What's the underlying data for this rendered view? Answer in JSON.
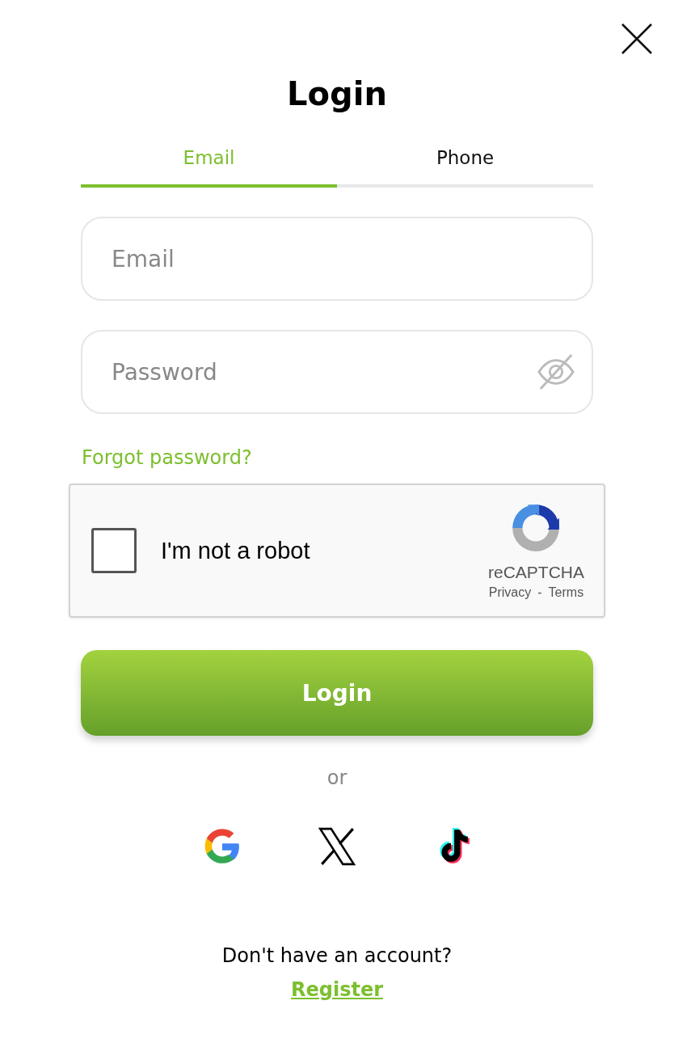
{
  "title": "Login",
  "tabs": [
    {
      "label": "Email",
      "selected": true
    },
    {
      "label": "Phone",
      "selected": false
    }
  ],
  "fields": [
    {
      "kind": "text",
      "placeholder": "Email"
    },
    {
      "kind": "password",
      "placeholder": "Password"
    }
  ],
  "forgot_link": "Forgot password?",
  "captcha": {
    "label": "I'm not a robot",
    "checked": false,
    "brand": "reCAPTCHA",
    "privacy": "Privacy",
    "separator": "-",
    "terms": "Terms"
  },
  "login_button": "Login",
  "divider_text": "or",
  "social": [
    {
      "kind": "google"
    },
    {
      "kind": "x"
    },
    {
      "kind": "tiktok"
    }
  ],
  "footer": {
    "prompt": "Don't have an account?",
    "link": "Register"
  }
}
